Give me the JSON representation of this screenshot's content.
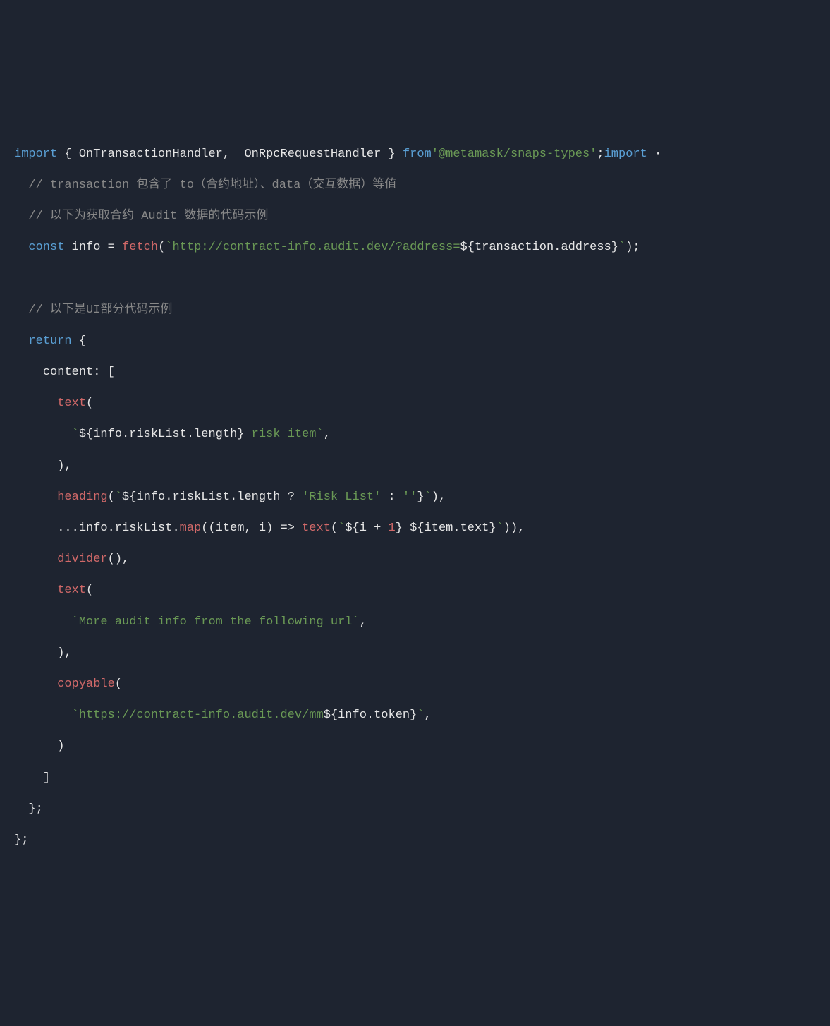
{
  "code": {
    "line1": {
      "import1": "import",
      "brace_open": " { ",
      "type1": "OnTransactionHandler",
      "comma": ",  ",
      "type2": "OnRpcRequestHandler",
      "brace_close": " } ",
      "from": "from",
      "pkg": "'@metamask/snaps-types'",
      "semi": ";",
      "import2": "import",
      "tail": " ·"
    },
    "line2": {
      "indent": "  ",
      "comment": "// transaction 包含了 to（合约地址）、data（交互数据）等值"
    },
    "line3": {
      "indent": "  ",
      "comment": "// 以下为获取合约 Audit 数据的代码示例"
    },
    "line4": {
      "indent": "  ",
      "const": "const",
      "sp1": " ",
      "ident": "info",
      "eq": " = ",
      "fn": "fetch",
      "paren_open": "(",
      "backtick1": "`",
      "url": "http://contract-info.audit.dev/?address=",
      "expr_open": "${",
      "expr": "transaction.address",
      "expr_close": "}",
      "backtick2": "`",
      "paren_close": ")",
      "semi": ";"
    },
    "line5": {
      "indent": "  ",
      "comment": "// 以下是UI部分代码示例"
    },
    "line6": {
      "indent": "  ",
      "return": "return",
      "brace": " {"
    },
    "line7": {
      "indent": "    ",
      "key": "content:",
      "bracket": " ["
    },
    "line8": {
      "indent": "      ",
      "fn": "text",
      "paren": "("
    },
    "line9": {
      "indent": "        ",
      "backtick1": "`",
      "expr_open": "${",
      "expr": "info.riskList.length",
      "expr_close": "}",
      "str": " risk item",
      "backtick2": "`",
      "comma": ","
    },
    "line10": {
      "indent": "      ",
      "paren": ")",
      "comma": ","
    },
    "line11": {
      "indent": "      ",
      "fn": "heading",
      "paren_open": "(",
      "backtick1": "`",
      "expr_open": "${",
      "expr1": "info.riskList.length ? ",
      "str1": "'Risk List'",
      "expr2": " : ",
      "str2": "''",
      "expr_close": "}",
      "backtick2": "`",
      "paren_close": ")",
      "comma": ","
    },
    "line12": {
      "indent": "      ",
      "spread": "...info.riskList.",
      "map": "map",
      "paren_open": "(",
      "params": "(item, i)",
      "arrow": " => ",
      "fn": "text",
      "paren2_open": "(",
      "backtick1": "`",
      "expr1_open": "${",
      "expr1a": "i + ",
      "num": "1",
      "expr1_close": "}",
      "sp": " ",
      "expr2_open": "${",
      "expr2": "item.text",
      "expr2_close": "}",
      "backtick2": "`",
      "paren2_close": ")",
      "paren_close": ")",
      "comma": ","
    },
    "line13": {
      "indent": "      ",
      "fn": "divider",
      "parens": "()",
      "comma": ","
    },
    "line14": {
      "indent": "      ",
      "fn": "text",
      "paren": "("
    },
    "line15": {
      "indent": "        ",
      "backtick1": "`",
      "str": "More audit info from the following url",
      "backtick2": "`",
      "comma": ","
    },
    "line16": {
      "indent": "      ",
      "paren": ")",
      "comma": ","
    },
    "line17": {
      "indent": "      ",
      "fn": "copyable",
      "paren": "("
    },
    "line18": {
      "indent": "        ",
      "backtick1": "`",
      "url": "https://contract-info.audit.dev/mm",
      "expr_open": "${",
      "expr": "info.token",
      "expr_close": "}",
      "backtick2": "`",
      "comma": ","
    },
    "line19": {
      "indent": "      ",
      "paren": ")"
    },
    "line20": {
      "indent": "    ",
      "bracket": "]"
    },
    "line21": {
      "indent": "  ",
      "brace": "}",
      "semi": ";"
    },
    "line22": {
      "brace": "}",
      "semi": ";"
    }
  }
}
